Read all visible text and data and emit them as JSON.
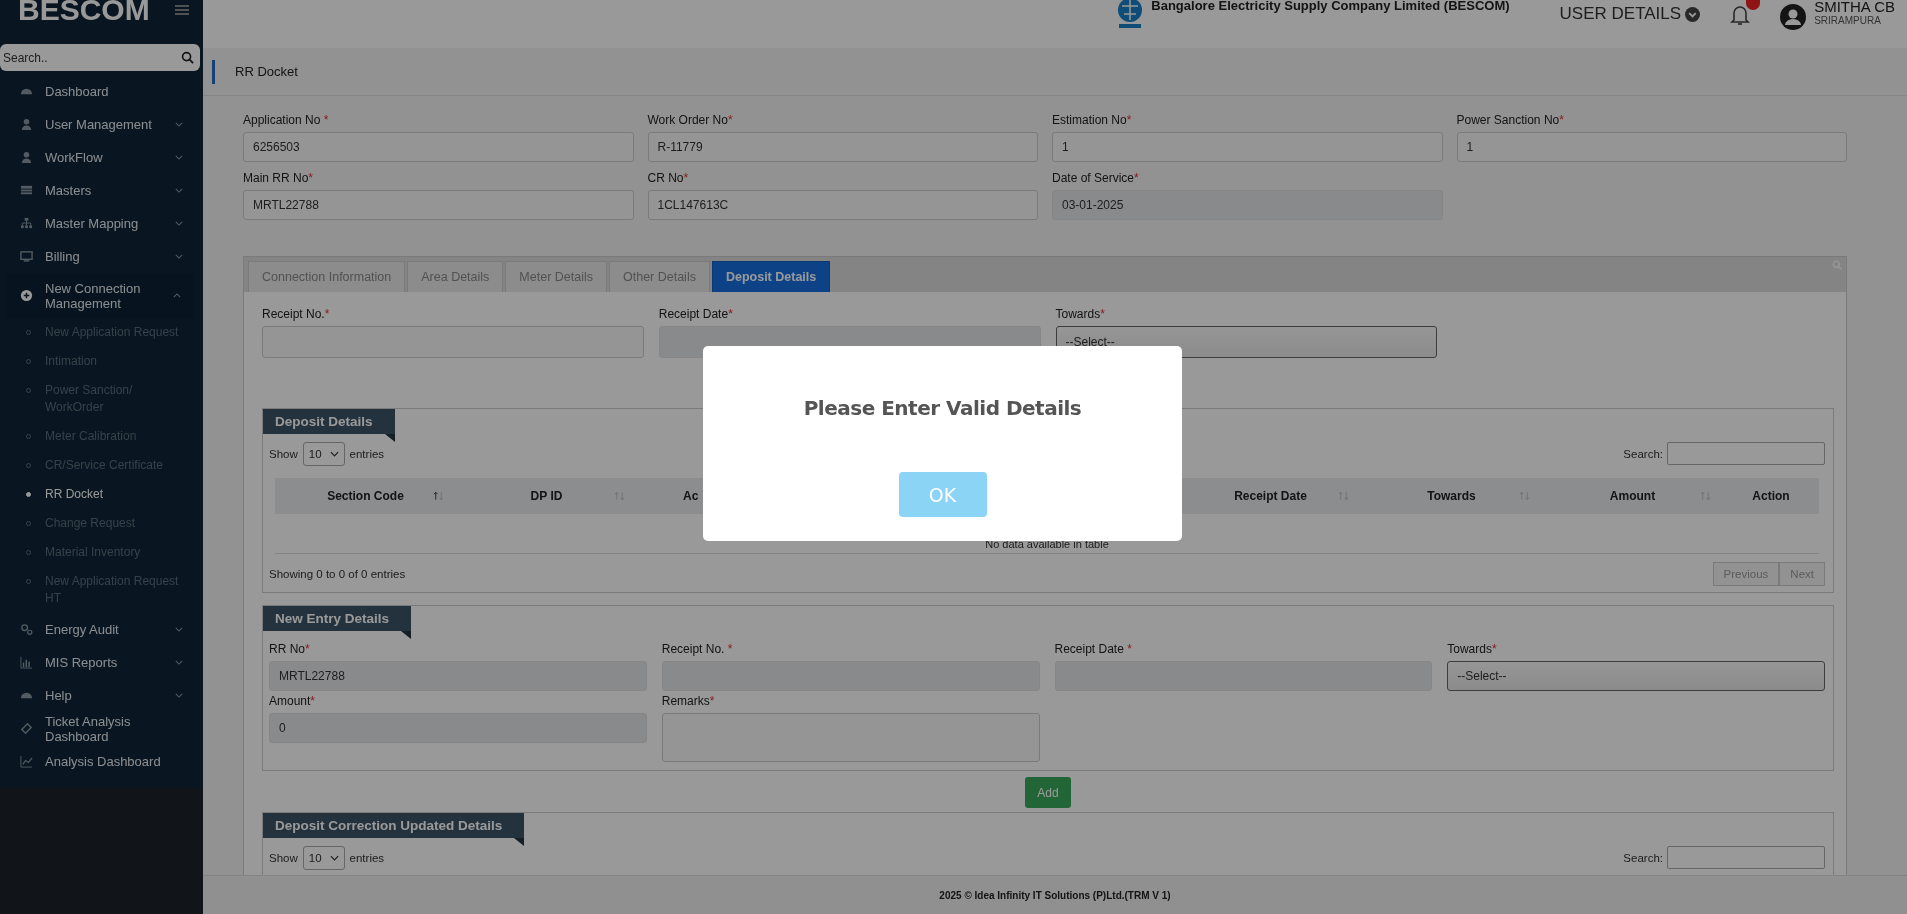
{
  "brand": "BESCOM",
  "header": {
    "company": "Bangalore Electricity Supply Company Limited (BESCOM)",
    "user_details": "USER DETAILS",
    "user_name": "SMITHA CB",
    "user_location": "SRIRAMPURA"
  },
  "sidebar": {
    "search_placeholder": "Search..",
    "items": [
      {
        "label": "Dashboard",
        "expandable": false,
        "expanded": false
      },
      {
        "label": "User Management",
        "expandable": true,
        "expanded": false
      },
      {
        "label": "WorkFlow",
        "expandable": true,
        "expanded": false
      },
      {
        "label": "Masters",
        "expandable": true,
        "expanded": false
      },
      {
        "label": "Master Mapping",
        "expandable": true,
        "expanded": false
      },
      {
        "label": "Billing",
        "expandable": true,
        "expanded": false
      },
      {
        "label": "New Connection Management",
        "expandable": true,
        "expanded": true,
        "children": [
          {
            "label": "New Application Request",
            "selected": false
          },
          {
            "label": "Intimation",
            "selected": false
          },
          {
            "label": "Power Sanction/ WorkOrder",
            "selected": false
          },
          {
            "label": "Meter Calibration",
            "selected": false
          },
          {
            "label": "CR/Service Certificate",
            "selected": false
          },
          {
            "label": "RR Docket",
            "selected": true
          },
          {
            "label": "Change Request",
            "selected": false
          },
          {
            "label": "Material Inventory",
            "selected": false
          },
          {
            "label": "New Application Request HT",
            "selected": false
          }
        ]
      },
      {
        "label": "Energy Audit",
        "expandable": true,
        "expanded": false
      },
      {
        "label": "MIS Reports",
        "expandable": true,
        "expanded": false
      },
      {
        "label": "Help",
        "expandable": true,
        "expanded": false
      },
      {
        "label": "Ticket Analysis Dashboard",
        "expandable": false,
        "expanded": false
      },
      {
        "label": "Analysis Dashboard",
        "expandable": false,
        "expanded": false
      }
    ]
  },
  "page_title": "RR Docket",
  "fields": [
    {
      "label": "Application No ",
      "mark": "*",
      "value": "6256503",
      "disabled": false
    },
    {
      "label": "Work Order No",
      "mark": "*",
      "value": "R-11779",
      "disabled": false
    },
    {
      "label": "Estimation No",
      "mark": "*",
      "value": "1",
      "disabled": false
    },
    {
      "label": "Power Sanction No",
      "mark": "*",
      "value": "1",
      "disabled": false
    },
    {
      "label": "Main RR No",
      "mark": "*",
      "value": "MRTL22788",
      "disabled": false
    },
    {
      "label": "CR No",
      "mark": "*",
      "value": "1CL147613C",
      "disabled": false
    },
    {
      "label": "Date of Service",
      "mark": "*",
      "value": "03-01-2025",
      "disabled": true
    }
  ],
  "tabs": [
    {
      "label": "Connection Information",
      "selected": false
    },
    {
      "label": "Area Details",
      "selected": false
    },
    {
      "label": "Meter Details",
      "selected": false
    },
    {
      "label": "Other Details",
      "selected": false
    },
    {
      "label": "Deposit Details",
      "selected": true
    }
  ],
  "receipt_fields": [
    {
      "kind": "input",
      "label": "Receipt No.",
      "mark": "*",
      "disabled": false
    },
    {
      "kind": "input",
      "label": "Receipt Date",
      "mark": "*",
      "disabled": true
    },
    {
      "kind": "select",
      "label": "Towards",
      "mark": "*",
      "value": "--Select--",
      "disabled": false
    }
  ],
  "deposit_details": {
    "title": "Deposit Details",
    "show": "Show",
    "page_size": "10",
    "entries": "entries",
    "search": "Search:",
    "columns": [
      {
        "label": "Section Code",
        "sortable": true,
        "covered": false
      },
      {
        "label": "DP ID",
        "sortable": true,
        "covered": false
      },
      {
        "label": "Ac",
        "sortable": false,
        "covered": true
      },
      {
        "label": "Receipt Date",
        "sortable": true,
        "covered": false
      },
      {
        "label": "Towards",
        "sortable": true,
        "covered": false
      },
      {
        "label": "Amount",
        "sortable": true,
        "covered": false
      },
      {
        "label": "Action",
        "sortable": false,
        "covered": false
      }
    ],
    "empty": "No data available in table",
    "info": "Showing 0 to 0 of 0 entries",
    "previous": "Previous",
    "next": "Next"
  },
  "new_entry": {
    "title": "New Entry Details",
    "fields": [
      {
        "kind": "input",
        "label": "RR No",
        "mark": "*",
        "value": "MRTL22788",
        "disabled": true
      },
      {
        "kind": "input",
        "label": "Receipt No. ",
        "mark": "*",
        "disabled": true
      },
      {
        "kind": "input",
        "label": "Receipt Date ",
        "mark": "*",
        "disabled": true
      },
      {
        "kind": "select",
        "label": "Towards",
        "mark": "*",
        "value": "--Select--",
        "disabled": false
      },
      {
        "kind": "input",
        "label": "Amount",
        "mark": "*",
        "value": "0",
        "disabled": true
      },
      {
        "kind": "textarea",
        "label": "Remarks",
        "mark": "*",
        "disabled": false
      }
    ],
    "add": "Add"
  },
  "correction": {
    "title": "Deposit Correction Updated Details",
    "show": "Show",
    "page_size": "10",
    "entries": "entries",
    "search": "Search:"
  },
  "footer": "2025 © Idea Infinity IT Solutions (P)Ltd.(TRM V 1)",
  "dialog": {
    "message": "Please Enter Valid Details",
    "ok": "OK"
  }
}
